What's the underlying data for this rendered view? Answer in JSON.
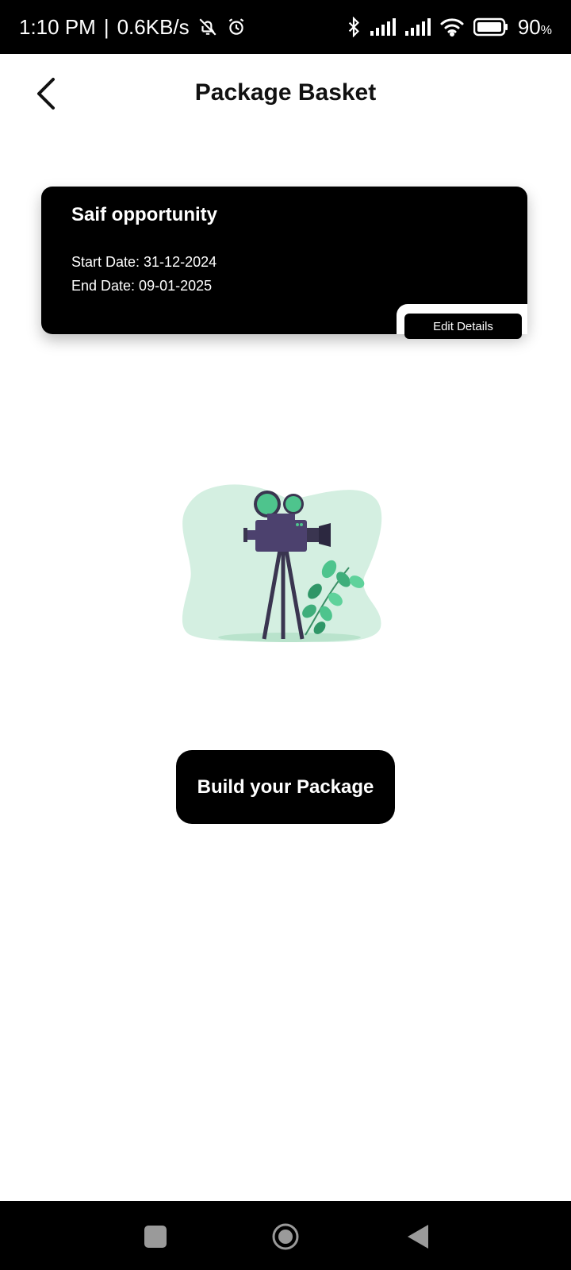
{
  "status_bar": {
    "time": "1:10 PM",
    "separator": "|",
    "speed": "0.6KB/s",
    "battery": "90",
    "battery_unit": "%",
    "icons": [
      "bell-off-icon",
      "alarm-icon",
      "bluetooth-icon",
      "signal-icon",
      "signal-icon",
      "wifi-icon",
      "battery-icon"
    ]
  },
  "header": {
    "title": "Package Basket",
    "back_icon": "chevron-left-icon"
  },
  "card": {
    "title": "Saif opportunity",
    "start_date": "Start Date: 31-12-2024",
    "end_date": "End Date: 09-01-2025",
    "edit_label": "Edit Details"
  },
  "main": {
    "illustration": "film-camera-illustration",
    "build_label": "Build your Package"
  },
  "nav": {
    "icons": [
      "square-recent-icon",
      "circle-home-icon",
      "triangle-back-icon"
    ]
  },
  "colors": {
    "primary": "#000000",
    "background": "#ffffff",
    "illustration_blob": "#d4efe1",
    "accent_green": "#4ec48d",
    "camera_purple": "#4c416e"
  }
}
